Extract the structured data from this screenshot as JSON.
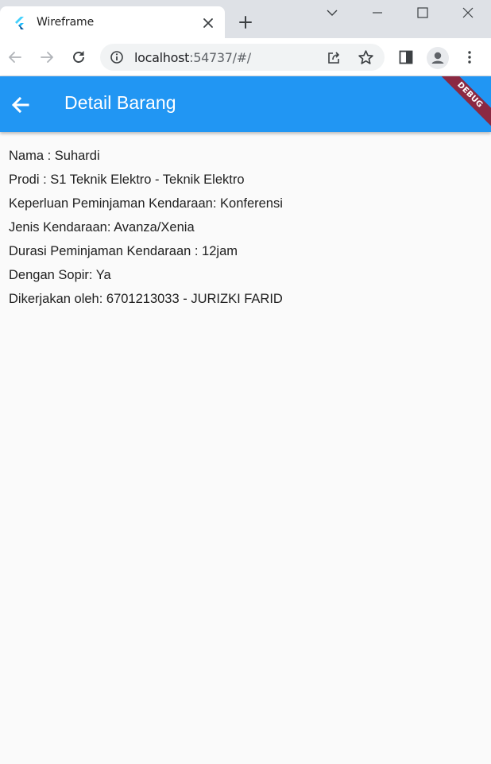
{
  "browser": {
    "tab": {
      "title": "Wireframe"
    },
    "address": {
      "host": "localhost",
      "path": ":54737/#/"
    }
  },
  "app": {
    "appbar": {
      "title": "Detail Barang"
    },
    "debug_banner": "DEBUG",
    "details": [
      "Nama : Suhardi",
      "Prodi : S1 Teknik Elektro - Teknik Elektro",
      "Keperluan Peminjaman Kendaraan: Konferensi",
      "Jenis Kendaraan: Avanza/Xenia",
      "Durasi Peminjaman Kendaraan : 12jam",
      "Dengan Sopir: Ya",
      "Dikerjakan oleh: 6701213033 - JURIZKI FARID"
    ]
  },
  "colors": {
    "appbar": "#2196f3",
    "debug_banner": "#8b2942",
    "background": "#fafafa"
  }
}
